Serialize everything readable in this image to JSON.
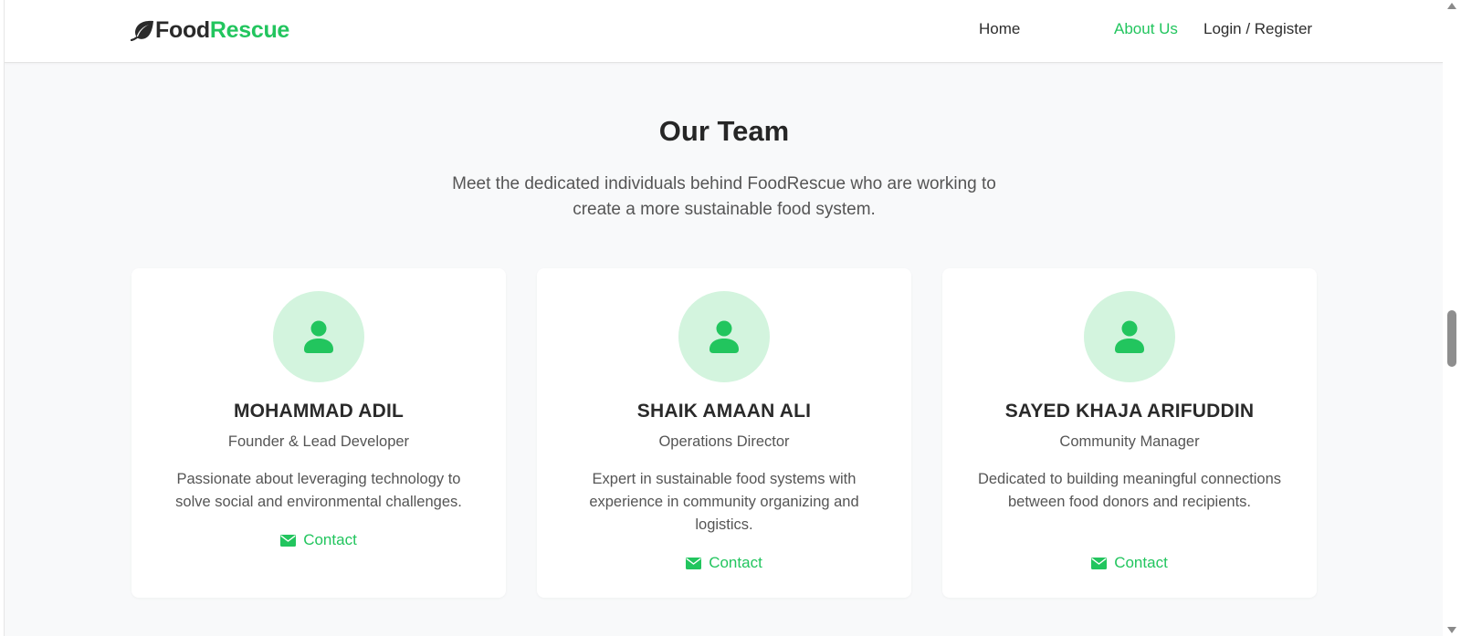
{
  "header": {
    "logo_food": "Food",
    "logo_rescue": "Rescue",
    "nav": {
      "home": "Home",
      "about": "About Us",
      "login": "Login / Register"
    }
  },
  "team": {
    "title": "Our Team",
    "subtitle": "Meet the dedicated individuals behind FoodRescue who are working to create a more sustainable food system.",
    "members": [
      {
        "name": "MOHAMMAD ADIL",
        "role": "Founder & Lead Developer",
        "bio": "Passionate about leveraging technology to solve social and environmental challenges.",
        "contact_label": "Contact"
      },
      {
        "name": "SHAIK AMAAN ALI",
        "role": "Operations Director",
        "bio": "Expert in sustainable food systems with experience in community organizing and logistics.",
        "contact_label": "Contact"
      },
      {
        "name": "SAYED KHAJA ARIFUDDIN",
        "role": "Community Manager",
        "bio": "Dedicated to building meaningful connections between food donors and recipients.",
        "contact_label": "Contact"
      }
    ]
  },
  "icons": {
    "logo": "leaf-icon",
    "avatar": "user-icon",
    "contact": "envelope-icon"
  },
  "colors": {
    "accent": "#22c55e",
    "avatar_bg": "#d3f4de",
    "page_bg": "#f8f9fa",
    "text_dark": "#2a2a2a",
    "text_muted": "#555555"
  }
}
